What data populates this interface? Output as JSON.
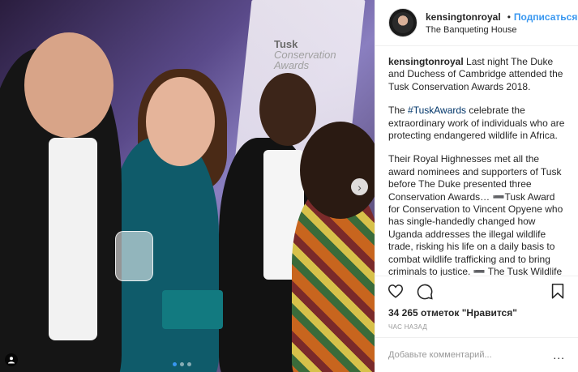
{
  "header": {
    "username": "kensingtonroyal",
    "separator": "•",
    "follow_label": "Подписаться",
    "location": "The Banqueting House",
    "verified_color": "#3897f0"
  },
  "media": {
    "banner_lines": [
      "Tusk",
      "Conservation",
      "Awards"
    ],
    "carousel_total": 3,
    "carousel_active": 1,
    "next_icon": "chevron-right-icon",
    "tag_icon": "user-tag-icon"
  },
  "caption": {
    "username": "kensingtonroyal",
    "p1": "Last night The Duke and Duchess of Cambridge attended the Tusk Conservation Awards 2018.",
    "p2_pre": "The ",
    "p2_tag": "#TuskAwards",
    "p2_post": " celebrate the extraordinary work of individuals who are protecting endangered wildlife in Africa.",
    "p3": "Their Royal Highnesses met all the award nominees and supporters of Tusk before The Duke presented three Conservation Awards… ➖Tusk Award for Conservation to Vincent Opyene who has single-handedly changed how Uganda addresses the illegal wildlife trade, risking his life on a daily basis to combat wildlife trafficking and to bring criminals to justice. ➖ The Tusk Wildlife Ranger Award to Julius Obwona for his leadership in Murchison Falls, Uganda which has led to the prosecution of 720 poachers and traffickers, and seizure of"
  },
  "actions": {
    "like_icon": "heart-icon",
    "comment_icon": "comment-icon",
    "save_icon": "bookmark-icon"
  },
  "likes": "34 265 отметок \"Нравится\"",
  "time": "час назад",
  "comment": {
    "placeholder": "Добавьте комментарий...",
    "more": "..."
  },
  "colors": {
    "accent": "#3897f0",
    "hashtag": "#003569",
    "border": "#efefef"
  }
}
